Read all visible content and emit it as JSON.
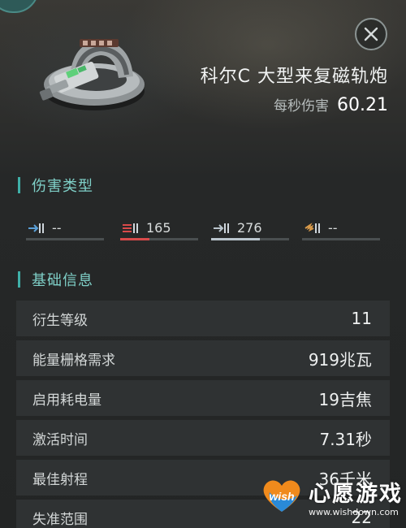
{
  "header": {
    "item_name": "科尔C 大型来复磁轨炮",
    "dps_label": "每秒伤害",
    "dps_value": "60.21",
    "close_icon": "close-icon",
    "item_icon": "railgun-turret-icon"
  },
  "damage_section": {
    "title": "伤害类型",
    "types": [
      {
        "icon": "em-damage-icon",
        "value": "--",
        "color": "#5aa0d8",
        "fill": 0
      },
      {
        "icon": "thermal-damage-icon",
        "value": "165",
        "color": "#d84a4a",
        "fill": 0.37
      },
      {
        "icon": "kinetic-damage-icon",
        "value": "276",
        "color": "#b9c4cc",
        "fill": 0.63
      },
      {
        "icon": "explosive-damage-icon",
        "value": "--",
        "color": "#d89a4a",
        "fill": 0
      }
    ]
  },
  "basic_section": {
    "title": "基础信息",
    "rows": [
      {
        "label": "衍生等级",
        "value": "11"
      },
      {
        "label": "能量栅格需求",
        "value": "919兆瓦"
      },
      {
        "label": "启用耗电量",
        "value": "19吉焦"
      },
      {
        "label": "激活时间",
        "value": "7.31秒"
      },
      {
        "label": "最佳射程",
        "value": "36千米"
      },
      {
        "label": "失准范围",
        "value": "22"
      }
    ]
  },
  "watermark": {
    "text": "心愿游戏",
    "url": "www.wishdown.com",
    "logo_text": "wish",
    "colors": {
      "orange": "#f08a1c",
      "blue": "#2a8ad8",
      "pink": "#e0408a"
    }
  }
}
